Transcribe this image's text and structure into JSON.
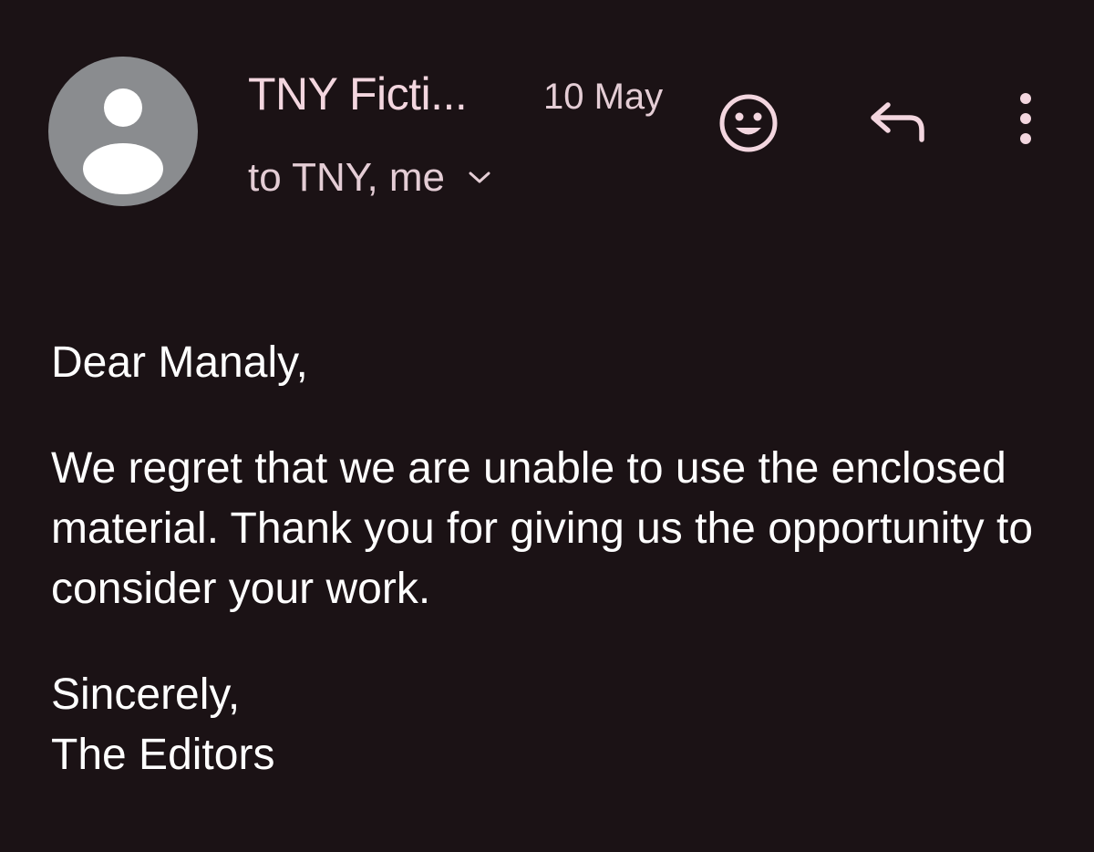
{
  "email": {
    "sender_name": "TNY Ficti...",
    "date": "10 May",
    "recipients": "to TNY, me",
    "body": {
      "greeting": "Dear Manaly,",
      "paragraph": "We regret that we are unable to use the enclosed material. Thank you for giving us the opportunity to consider your work.",
      "closing": "Sincerely,",
      "signature": "The Editors"
    }
  },
  "icons": {
    "avatar": "person-icon",
    "emoji": "emoji-reaction-icon",
    "reply": "reply-icon",
    "more": "more-vert-icon",
    "expand": "chevron-down-icon"
  },
  "colors": {
    "background": "#1b1215",
    "header_text": "#f3d6df",
    "body_text": "#ffffff",
    "avatar_bg": "#8a8c8f"
  }
}
